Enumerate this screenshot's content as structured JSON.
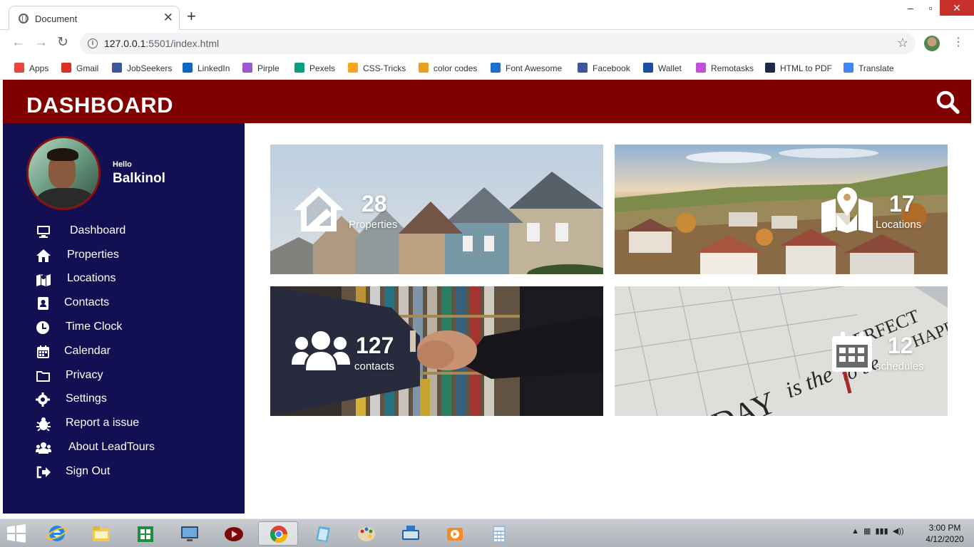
{
  "browser": {
    "tab_title": "Document",
    "url_host": "127.0.0.1",
    "url_rest": ":5501/index.html",
    "bookmarks": [
      {
        "label": "Apps",
        "icon": "apps-grid-icon",
        "color": "#e8453c"
      },
      {
        "label": "Gmail",
        "icon": "gmail-icon",
        "color": "#d93025"
      },
      {
        "label": "JobSeekers",
        "icon": "jobseekers-icon",
        "color": "#3b5998"
      },
      {
        "label": "LinkedIn",
        "icon": "linkedin-icon",
        "color": "#0a66c2"
      },
      {
        "label": "Pirple",
        "icon": "pirple-icon",
        "color": "#9b59d0"
      },
      {
        "label": "Pexels",
        "icon": "pexels-icon",
        "color": "#05a081"
      },
      {
        "label": "CSS-Tricks",
        "icon": "css-tricks-icon",
        "color": "#f5a623"
      },
      {
        "label": "color codes",
        "icon": "color-codes-icon",
        "color": "#e8a020"
      },
      {
        "label": "Font Awesome",
        "icon": "font-awesome-icon",
        "color": "#1f6fd0"
      },
      {
        "label": "Facebook",
        "icon": "facebook-icon",
        "color": "#3b5998"
      },
      {
        "label": "Wallet",
        "icon": "wallet-icon",
        "color": "#1a4fa0"
      },
      {
        "label": "Remotasks",
        "icon": "remotasks-icon",
        "color": "#c24fd8"
      },
      {
        "label": "HTML to PDF",
        "icon": "html-to-pdf-icon",
        "color": "#1b2a4a"
      },
      {
        "label": "Translate",
        "icon": "translate-icon",
        "color": "#4285f4"
      }
    ]
  },
  "header": {
    "title": "DASHBOARD",
    "search_icon": "search-icon"
  },
  "user": {
    "greeting": "Hello",
    "name": "Balkinol"
  },
  "sidebar": {
    "items": [
      {
        "label": "Dashboard",
        "icon": "desktop-icon"
      },
      {
        "label": "Properties",
        "icon": "home-icon"
      },
      {
        "label": "Locations",
        "icon": "map-icon"
      },
      {
        "label": "Contacts",
        "icon": "address-book-icon"
      },
      {
        "label": "Time Clock",
        "icon": "clock-icon"
      },
      {
        "label": "Calendar",
        "icon": "calendar-icon"
      },
      {
        "label": "Privacy",
        "icon": "folder-icon"
      },
      {
        "label": "Settings",
        "icon": "gear-icon"
      },
      {
        "label": "Report a issue",
        "icon": "bug-icon"
      },
      {
        "label": "About LeadTours",
        "icon": "users-icon"
      },
      {
        "label": "Sign Out",
        "icon": "sign-out-icon"
      }
    ]
  },
  "cards": [
    {
      "count": "28",
      "label": "Properties",
      "icon": "home-icon"
    },
    {
      "count": "17",
      "label": "Locations",
      "icon": "map-icon"
    },
    {
      "count": "127",
      "label": "contacts",
      "icon": "users-icon"
    },
    {
      "count": "12",
      "label": "schedules",
      "icon": "calendar-icon"
    }
  ],
  "colors": {
    "topbar": "#800000",
    "sidebar": "#121053",
    "text": "#ffffff"
  },
  "taskbar": {
    "apps": [
      "internet-explorer-icon",
      "file-explorer-icon",
      "store-icon",
      "remote-desktop-icon",
      "media-player-icon",
      "chrome-icon",
      "notes-icon",
      "paint-icon",
      "keyboard-icon",
      "video-icon",
      "calculator-icon"
    ],
    "time": "3:00 PM",
    "date": "4/12/2020"
  }
}
